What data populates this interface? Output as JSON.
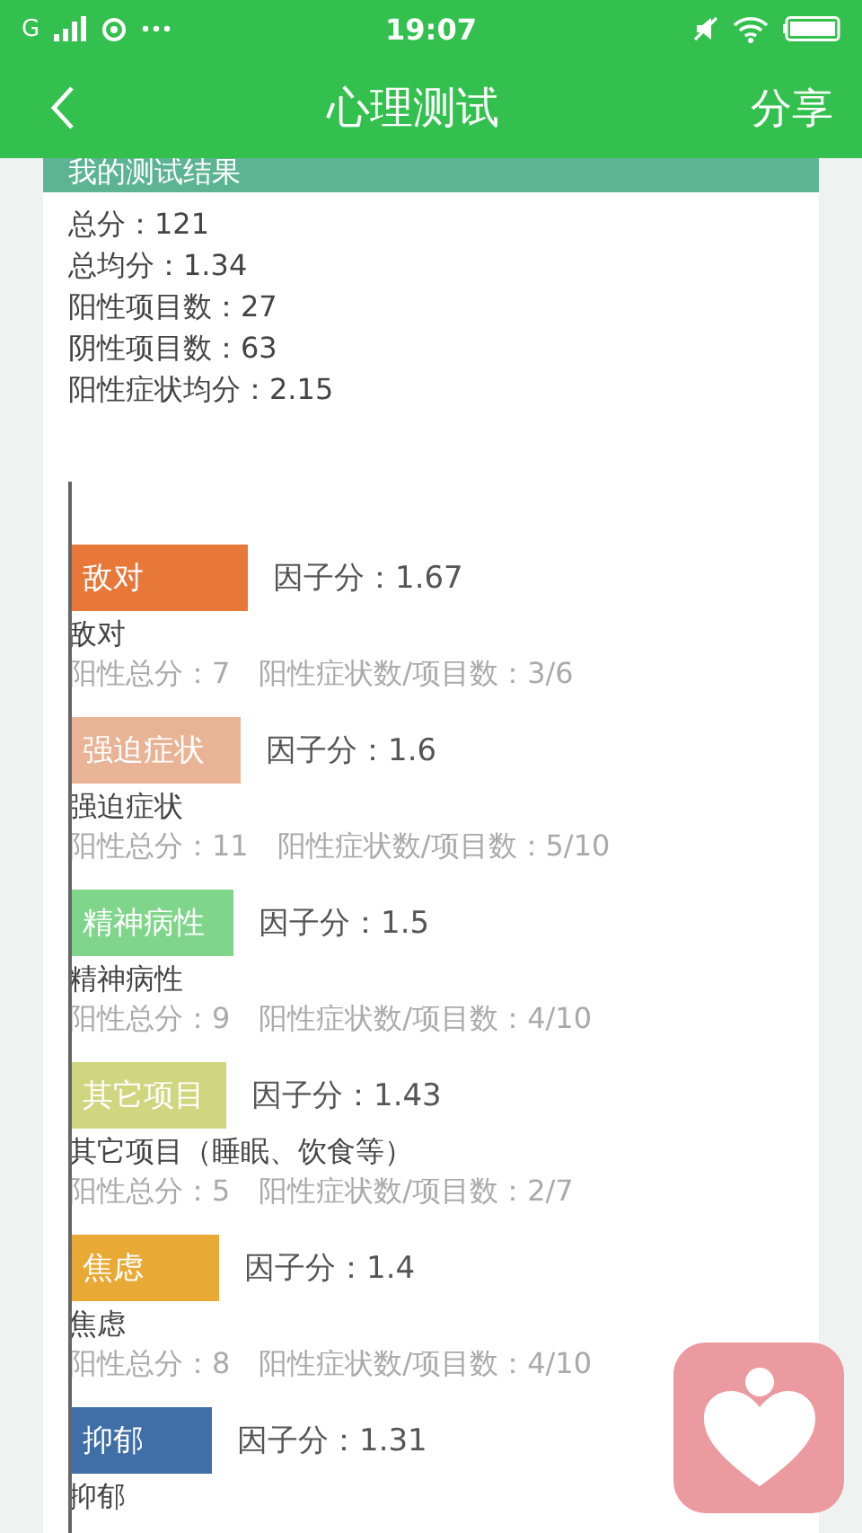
{
  "status_bar": {
    "network": "G",
    "time": "19:07"
  },
  "header": {
    "title": "心理测试",
    "action": "分享"
  },
  "card": {
    "title": "我的测试结果",
    "summary": [
      "总分：121",
      "总均分：1.34",
      "阳性项目数：27",
      "阴性项目数：63",
      "阳性症状均分：2.15"
    ],
    "factors": [
      {
        "label": "敌对",
        "score": "因子分：1.67",
        "color": "#e8773a",
        "name": "敌对",
        "stats": "阳性总分：7　阳性症状数/项目数：3/6"
      },
      {
        "label": "强迫症状",
        "score": "因子分：1.6",
        "color": "#e9b395",
        "name": "强迫症状",
        "stats": "阳性总分：11　阳性症状数/项目数：5/10"
      },
      {
        "label": "精神病性",
        "score": "因子分：1.5",
        "color": "#7fd58a",
        "name": "精神病性",
        "stats": "阳性总分：9　阳性症状数/项目数：4/10"
      },
      {
        "label": "其它项目",
        "score": "因子分：1.43",
        "color": "#cfd67f",
        "name": "其它项目（睡眠、饮食等）",
        "stats": "阳性总分：5　阳性症状数/项目数：2/7"
      },
      {
        "label": "焦虑",
        "score": "因子分：1.4",
        "color": "#e9a935",
        "name": "焦虑",
        "stats": "阳性总分：8　阳性症状数/项目数：4/10"
      },
      {
        "label": "抑郁",
        "score": "因子分：1.31",
        "color": "#3f6fa6",
        "name": "抑郁"
      }
    ]
  }
}
